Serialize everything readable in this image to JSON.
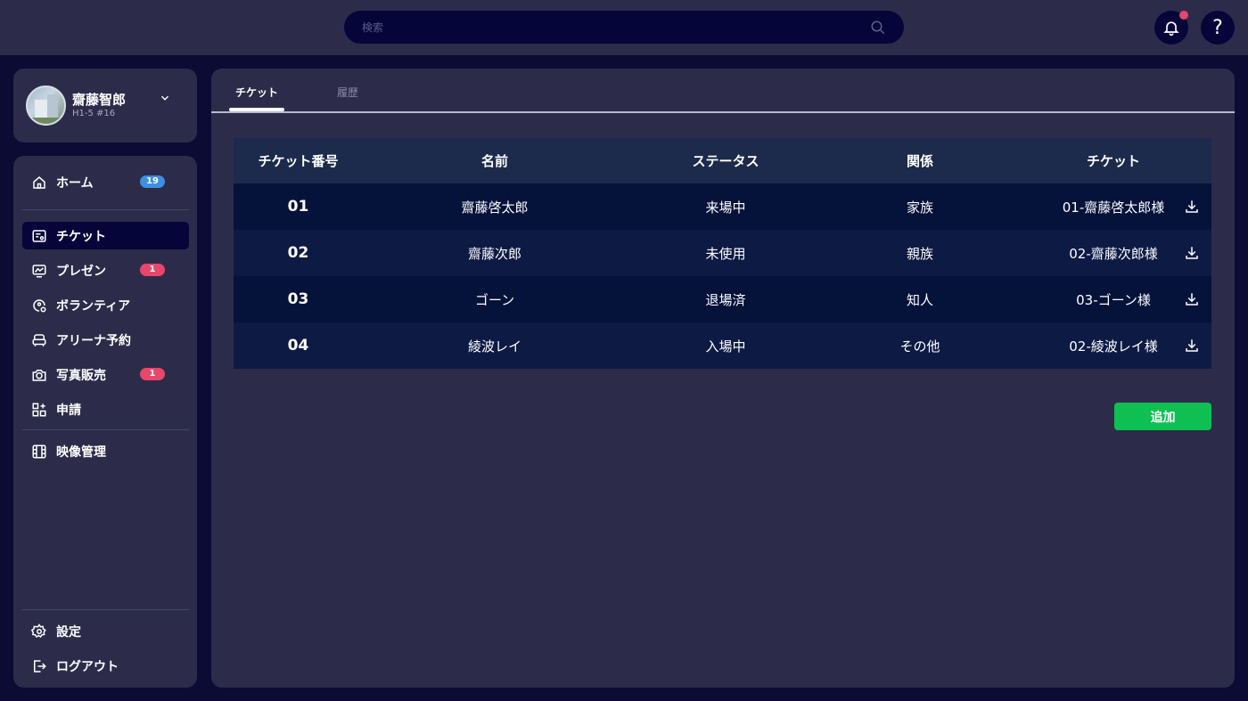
{
  "search": {
    "placeholder": "検索"
  },
  "help": {
    "label": "?"
  },
  "profile": {
    "name": "齋藤智郎",
    "sub": "H1-5 #16"
  },
  "nav": {
    "items": [
      {
        "label": "ホーム",
        "icon": "home-icon",
        "badge": "19"
      },
      {
        "label": "チケット",
        "icon": "ticket-icon"
      },
      {
        "label": "プレゼン",
        "icon": "presentation-icon",
        "badge": "1"
      },
      {
        "label": "ボランティア",
        "icon": "volunteer-icon"
      },
      {
        "label": "アリーナ予約",
        "icon": "sofa-icon"
      },
      {
        "label": "写真販売",
        "icon": "camera-icon",
        "badge": "1"
      },
      {
        "label": "申請",
        "icon": "apps-add-icon"
      },
      {
        "label": "映像管理",
        "icon": "film-icon"
      },
      {
        "label": "設定",
        "icon": "gear-icon"
      },
      {
        "label": "ログアウト",
        "icon": "logout-icon"
      }
    ]
  },
  "tabs": [
    {
      "label": "チケット",
      "active": true
    },
    {
      "label": "履歴",
      "active": false
    }
  ],
  "table": {
    "headers": [
      "チケット番号",
      "名前",
      "ステータス",
      "関係",
      "チケット"
    ],
    "rows": [
      [
        "01",
        "齋藤啓太郎",
        "来場中",
        "家族",
        "01-齋藤啓太郎様"
      ],
      [
        "02",
        "齋藤次郎",
        "未使用",
        "親族",
        "02-齋藤次郎様"
      ],
      [
        "03",
        "ゴーン",
        "退場済",
        "知人",
        "03-ゴーン様"
      ],
      [
        "04",
        "綾波レイ",
        "入場中",
        "その他",
        "02-綾波レイ様"
      ]
    ]
  },
  "actions": {
    "add_label": "追加"
  },
  "colors": {
    "accent_green": "#0ec052",
    "badge_blue": "#3d8fe0",
    "badge_red": "#e8466a",
    "panel": "#2c2c4a",
    "background": "#0b0b34"
  }
}
